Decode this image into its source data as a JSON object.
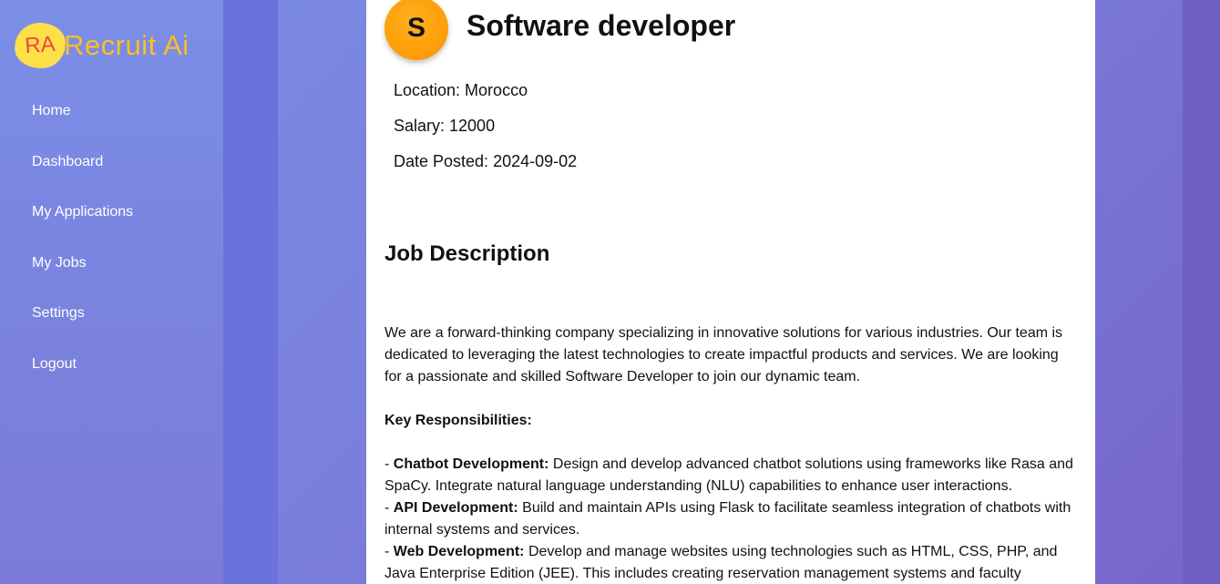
{
  "logo": {
    "badge": "RA",
    "text": "Recruit Ai"
  },
  "sidebar": {
    "items": [
      {
        "label": "Home"
      },
      {
        "label": "Dashboard"
      },
      {
        "label": "My Applications"
      },
      {
        "label": "My Jobs"
      },
      {
        "label": "Settings"
      },
      {
        "label": "Logout"
      }
    ]
  },
  "job": {
    "avatar_letter": "S",
    "title": "Software developer",
    "location": "Location: Morocco",
    "salary": "Salary: 12000",
    "date_posted": "Date Posted: 2024-09-02",
    "description_heading": "Job Description",
    "intro": "We are a forward-thinking company specializing in innovative solutions for various industries. Our team is dedicated to leveraging the latest technologies to create impactful products and services. We are looking for a passionate and skilled Software Developer to join our dynamic team.",
    "responsibilities_heading": "Key Responsibilities:",
    "responsibilities": [
      {
        "prefix": "- ",
        "title": "Chatbot Development:",
        "text": " Design and develop advanced chatbot solutions using frameworks like Rasa and SpaCy. Integrate natural language understanding (NLU) capabilities to enhance user interactions."
      },
      {
        "prefix": "- ",
        "title": "API Development:",
        "text": " Build and maintain APIs using Flask to facilitate seamless integration of chatbots with internal systems and services."
      },
      {
        "prefix": "- ",
        "title": "Web Development:",
        "text": " Develop and manage websites using technologies such as HTML, CSS, PHP, and Java Enterprise Edition (JEE). This includes creating reservation management systems and faculty"
      }
    ]
  },
  "colors": {
    "sidebar_bg": "#7b8ee8",
    "avatar": "#ff9f0a",
    "logo_badge": "#fde047",
    "logo_text": "#fbbf24"
  }
}
